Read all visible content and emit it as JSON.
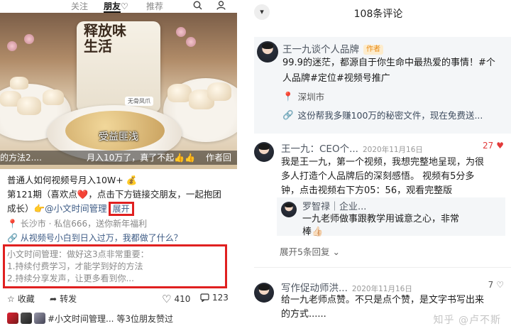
{
  "left_post": {
    "tabs": [
      "关注",
      "朋友",
      "推荐"
    ],
    "video": {
      "bag_text": "释放味生活",
      "bag_badge": "无骨凤爪",
      "subtitle": "受益匪浅",
      "banner_left": "的方法2....",
      "banner_mid": "月入10万了，真了不起👍👍",
      "banner_right": "作者回"
    },
    "title_line": "普通人如何视频号月入10W+ 💰",
    "episode_line": "第121期（喜欢点❤️，点击下方链接交朋友，一起抱团",
    "growth_prefix": "成长）👉",
    "growth_account": "@小文时间管理",
    "expand_label": "展开",
    "location": "📍 长沙市 · 私信666，送你新年福利",
    "promo_link": "🔗 从视频号小白到日入过万，我都做了什么？",
    "reply_lines": [
      "小文时间管理：做好这3点非常重要：",
      "1.持续付费学习，才能学到好的方法",
      "2.持续分享发声，让更多看到你..."
    ],
    "actions": {
      "favorite": "收藏",
      "share": "转发",
      "likes": "410",
      "comments": "123"
    },
    "likers_text": "#小文时间管理...  等3位朋友赞过"
  },
  "right_comments": {
    "header_title": "108条评论",
    "author_card": {
      "name": "王一九谈个人品牌",
      "tag": "作者",
      "text_line1": "99.9的迷茫，都源自于你生命中最热爱的事情！#个",
      "text_line2": "人品牌#定位#视频号推广",
      "location": "深圳市",
      "link": "这份帮我多赚100万的秘密文件，现在免费送..."
    },
    "comments": [
      {
        "name": "王一九：CEO个...",
        "date": "2020年11月16日",
        "likes": "27",
        "lines": [
          "我是王一九，第一个视频，我想完整地呈现，为很",
          "多人打造个人品牌后的深刻感悟。 视频有5分多",
          "钟，点击视频右下方05：56，观看完整版"
        ],
        "reply": {
          "name": "罗智禄｜企业...",
          "lines": [
            "一九老师做事跟教学用诚意之心，非常",
            "棒👍🏻"
          ]
        },
        "expand": "展开5条回复"
      },
      {
        "name": "写作促动师洪...",
        "date": "2020年11月16日",
        "likes": "7",
        "lines": [
          "给一九老师点赞。不只是点个赞，是文字书写出来",
          "的方式......"
        ]
      }
    ],
    "watermark": "知乎 @卢不斯"
  }
}
